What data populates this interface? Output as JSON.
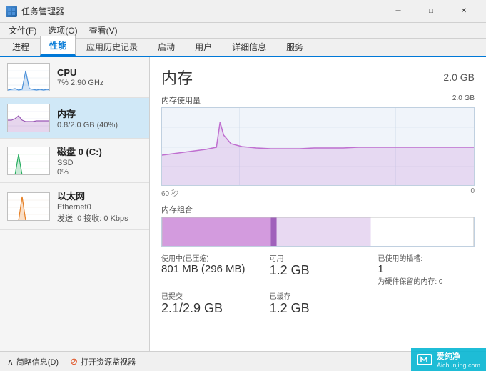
{
  "titlebar": {
    "title": "任务管理器",
    "min_label": "─",
    "max_label": "□",
    "close_label": "✕"
  },
  "menubar": {
    "items": [
      {
        "label": "文件(F)"
      },
      {
        "label": "选项(O)"
      },
      {
        "label": "查看(V)"
      }
    ]
  },
  "tabs": [
    {
      "label": "进程"
    },
    {
      "label": "性能",
      "active": true
    },
    {
      "label": "应用历史记录"
    },
    {
      "label": "启动"
    },
    {
      "label": "用户"
    },
    {
      "label": "详细信息"
    },
    {
      "label": "服务"
    }
  ],
  "sidebar": {
    "items": [
      {
        "name": "CPU",
        "detail1": "7% 2.90 GHz",
        "detail2": "",
        "active": false
      },
      {
        "name": "内存",
        "detail1": "0.8/2.0 GB (40%)",
        "detail2": "",
        "active": true
      },
      {
        "name": "磁盘 0 (C:)",
        "detail1": "SSD",
        "detail2": "0%",
        "active": false
      },
      {
        "name": "以太网",
        "detail1": "Ethernet0",
        "detail2": "发送: 0 接收: 0 Kbps",
        "active": false
      }
    ]
  },
  "panel": {
    "title": "内存",
    "total": "2.0 GB",
    "chart1_label": "内存使用量",
    "chart1_max": "2.0 GB",
    "time_label_left": "60 秒",
    "time_label_right": "0",
    "chart2_label": "内存组合",
    "stats": [
      {
        "label": "使用中(已压缩)",
        "value": "801 MB (296 MB)",
        "is_large": false,
        "large_value": "801 MB (296 MB)"
      },
      {
        "label": "可用",
        "value": "1.2 GB",
        "is_large": true
      },
      {
        "label": "已使用的插槽:",
        "value": "1",
        "extra": "为硬件保留的内存: 0"
      },
      {
        "label": "已提交",
        "value": "2.1/2.9 GB"
      },
      {
        "label": "已缓存",
        "value": "1.2 GB"
      }
    ]
  },
  "footer": {
    "summary_label": "简略信息(D)",
    "monitor_label": "打开资源监视器",
    "chevron": "∧"
  },
  "watermark": {
    "logo": "⌐■",
    "text": "爱纯净",
    "sub": "Aichunjing.com"
  }
}
